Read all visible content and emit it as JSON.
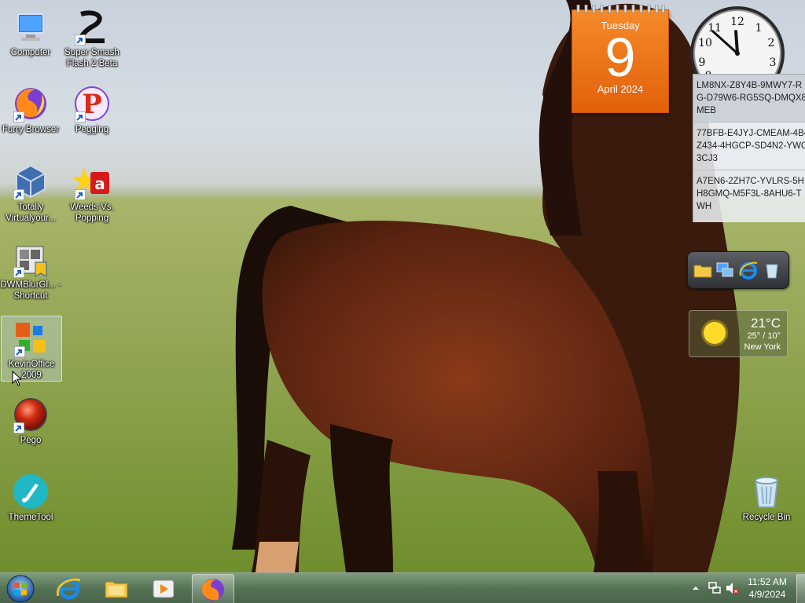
{
  "desktop": {
    "icons": [
      {
        "label": "Computer",
        "icon": "computer-icon"
      },
      {
        "label": "Super Smash Flash 2 Beta",
        "icon": "super-smash-flash-icon"
      },
      {
        "label": "Furry Browser",
        "icon": "firefox-icon"
      },
      {
        "label": "Pegging",
        "icon": "pegging-icon"
      },
      {
        "label": "Totally Virtualyour...",
        "icon": "virtualbox-icon"
      },
      {
        "label": "Weeds Vs. Popping",
        "icon": "weeds-vs-popping-icon"
      },
      {
        "label": "DWMBlurGl... - Shortcut",
        "icon": "dwmblur-icon"
      },
      {
        "label": "KevinOffice 2009",
        "icon": "office-icon"
      },
      {
        "label": "Pego",
        "icon": "pego-icon"
      },
      {
        "label": "ThemeTool",
        "icon": "themetool-icon"
      },
      {
        "label": "Recycle Bin",
        "icon": "recycle-bin-icon"
      }
    ]
  },
  "calendar": {
    "day": "Tuesday",
    "date": "9",
    "month": "April 2024"
  },
  "clock": {
    "hour": 11,
    "minute": 52
  },
  "keys": [
    {
      "line1": "LM8NX-Z8Y4B-9MWY7-R",
      "line2": "G-D79W6-RG5SQ-DMQX8",
      "line3": "MEB"
    },
    {
      "line1": "77BFB-E4JYJ-CMEAM-4B4",
      "line2": "Z434-4HGCP-SD4N2-YWC",
      "line3": "3CJ3"
    },
    {
      "line1": "A7EN6-2ZH7C-YVLRS-5H",
      "line2": "H8GMQ-M5F3L-8AHU6-T",
      "line3": "WH"
    }
  ],
  "weather": {
    "temp": "21°C",
    "hilo": "25° / 10°",
    "city": "New York"
  },
  "taskbar": {
    "items": [
      "start-orb-icon",
      "internet-explorer-icon",
      "file-explorer-icon",
      "media-player-icon",
      "firefox-icon"
    ],
    "time": "11:52 AM",
    "date": "4/9/2024"
  },
  "colors": {
    "calendar": "#f0781c",
    "taskbar": "#5f8a5f"
  }
}
